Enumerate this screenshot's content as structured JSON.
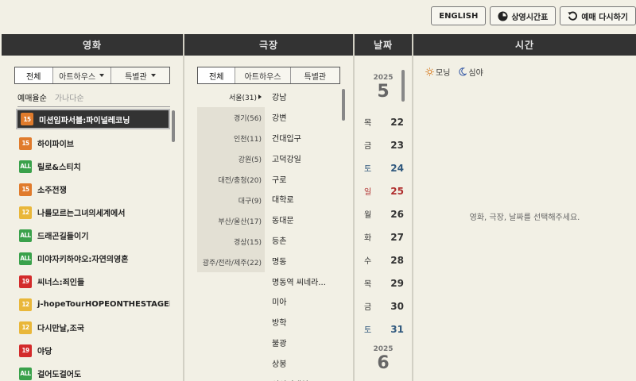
{
  "top_buttons": {
    "english": "ENGLISH",
    "schedule": "상영시간표",
    "reset": "예매 다시하기"
  },
  "columns": {
    "movie": "영화",
    "theater": "극장",
    "date": "날짜",
    "time": "시간"
  },
  "movie": {
    "tabs": [
      "전체",
      "아트하우스",
      "특별관"
    ],
    "sort": [
      "예매율순",
      "가나다순"
    ],
    "items": [
      {
        "age": "15",
        "title": "미션임파서블:파이널레코닝"
      },
      {
        "age": "15",
        "title": "하이파이브"
      },
      {
        "age": "ALL",
        "title": "릴로&스티치"
      },
      {
        "age": "15",
        "title": "소주전쟁"
      },
      {
        "age": "12",
        "title": "나를모르는그녀의세계에서"
      },
      {
        "age": "ALL",
        "title": "드래곤길들이기"
      },
      {
        "age": "ALL",
        "title": "미야자키하야오:자연의영혼"
      },
      {
        "age": "19",
        "title": "씨너스:죄인들"
      },
      {
        "age": "12",
        "title": "j-hopeTourHOPEONTHESTAGEinJ..."
      },
      {
        "age": "12",
        "title": "다시만날,조국"
      },
      {
        "age": "19",
        "title": "야당"
      },
      {
        "age": "ALL",
        "title": "걸어도걸어도"
      }
    ]
  },
  "theater": {
    "tabs": [
      "전체",
      "아트하우스",
      "특별관"
    ],
    "regions": [
      "서울(31)",
      "경기(56)",
      "인천(11)",
      "강원(5)",
      "대전/충청(20)",
      "대구(9)",
      "부산/울산(17)",
      "경상(15)",
      "광주/전라/제주(22)"
    ],
    "theaters": [
      "강남",
      "강변",
      "건대입구",
      "고덕강일",
      "구로",
      "대학로",
      "동대문",
      "등촌",
      "명동",
      "명동역 씨네라...",
      "미아",
      "방학",
      "불광",
      "상봉",
      "성신여대입구"
    ]
  },
  "date": {
    "may": {
      "year": "2025",
      "month": "5"
    },
    "june": {
      "year": "2025",
      "month": "6"
    },
    "days": [
      {
        "day": "목",
        "num": "22",
        "type": "weekday"
      },
      {
        "day": "금",
        "num": "23",
        "type": "weekday"
      },
      {
        "day": "토",
        "num": "24",
        "type": "sat"
      },
      {
        "day": "일",
        "num": "25",
        "type": "sun"
      },
      {
        "day": "월",
        "num": "26",
        "type": "weekday"
      },
      {
        "day": "화",
        "num": "27",
        "type": "weekday"
      },
      {
        "day": "수",
        "num": "28",
        "type": "weekday"
      },
      {
        "day": "목",
        "num": "29",
        "type": "weekday"
      },
      {
        "day": "금",
        "num": "30",
        "type": "weekday"
      },
      {
        "day": "토",
        "num": "31",
        "type": "sat"
      }
    ]
  },
  "time": {
    "legend": [
      "모닝",
      "심야"
    ],
    "message": "영화, 극장, 날짜를 선택해주세요."
  },
  "colors": {
    "age_15": "#e07b2c",
    "age_12": "#e9b73a",
    "age_19": "#d32b2b",
    "age_all": "#3aa14b",
    "header_bg": "#333333",
    "saturday": "#31597e",
    "sunday": "#af2d2d"
  }
}
